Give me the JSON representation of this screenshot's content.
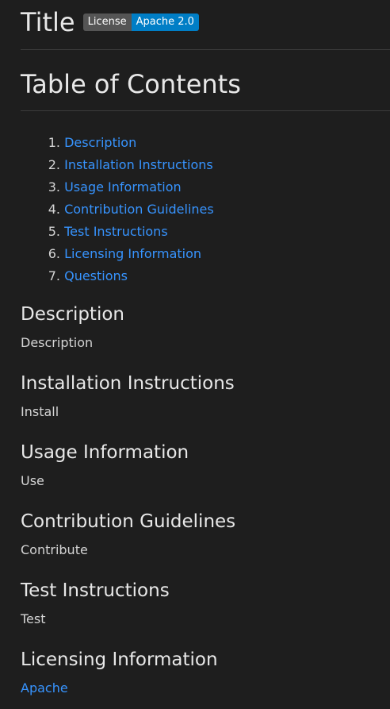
{
  "header": {
    "title": "Title",
    "badge": {
      "label": "License",
      "value": "Apache 2.0",
      "label_color": "#555555",
      "value_color": "#007ec6"
    }
  },
  "toc": {
    "heading": "Table of Contents",
    "items": [
      {
        "num": "1.",
        "label": "Description"
      },
      {
        "num": "2.",
        "label": "Installation Instructions"
      },
      {
        "num": "3.",
        "label": "Usage Information"
      },
      {
        "num": "4.",
        "label": "Contribution Guidelines"
      },
      {
        "num": "5.",
        "label": "Test Instructions"
      },
      {
        "num": "6.",
        "label": "Licensing Information"
      },
      {
        "num": "7.",
        "label": "Questions"
      }
    ]
  },
  "sections": [
    {
      "heading": "Description",
      "body": "Description"
    },
    {
      "heading": "Installation Instructions",
      "body": "Install"
    },
    {
      "heading": "Usage Information",
      "body": "Use"
    },
    {
      "heading": "Contribution Guidelines",
      "body": "Contribute"
    },
    {
      "heading": "Test Instructions",
      "body": "Test"
    },
    {
      "heading": "Licensing Information",
      "body": "Apache"
    }
  ],
  "colors": {
    "background": "#1e1e1e",
    "link": "#3794ff",
    "text": "#d4d4d4"
  }
}
